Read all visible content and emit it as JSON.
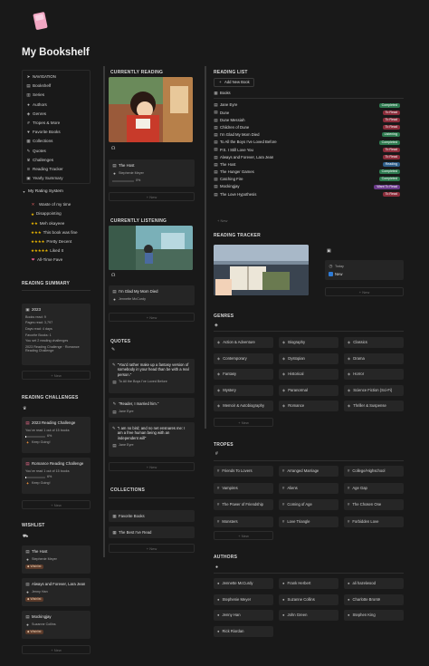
{
  "page": {
    "title": "My Bookshelf"
  },
  "navigation": {
    "title": "NAVIGATION",
    "items": [
      {
        "label": "Bookshelf"
      },
      {
        "label": "Series"
      },
      {
        "label": "Authors"
      },
      {
        "label": "Genres"
      },
      {
        "label": "Tropes & More"
      },
      {
        "label": "Favorite Books"
      },
      {
        "label": "Collections"
      },
      {
        "label": "Quotes"
      },
      {
        "label": "Challenges"
      },
      {
        "label": "Reading Tracker"
      },
      {
        "label": "Yearly Summary"
      }
    ]
  },
  "rating_system": {
    "title": "My Rating System",
    "items": [
      {
        "stars": "",
        "label": "Waste of my time"
      },
      {
        "stars": "★",
        "label": "Disappointing"
      },
      {
        "stars": "★★",
        "label": "Meh okayeee"
      },
      {
        "stars": "★★★",
        "label": "This book was fine"
      },
      {
        "stars": "★★★★",
        "label": "Pretty Decent"
      },
      {
        "stars": "★★★★★",
        "label": "Liked It"
      },
      {
        "stars": "",
        "label": "All-Time Fave"
      }
    ]
  },
  "reading_summary": {
    "title": "READING SUMMARY",
    "year": "2023",
    "lines": [
      "Books read: 9",
      "Pages read: 3,797",
      "Days read: 4 days",
      "Favorite Books: 1",
      "You set 2 reading challenges",
      "2023 Reading Challenge · Romance Reading Challenge"
    ],
    "new_label": "+ New"
  },
  "reading_challenges": {
    "title": "READING CHALLENGES",
    "items": [
      {
        "title": "2023 Reading Challenge",
        "detail": "You've read 1 out of 15 books",
        "percent": "6%",
        "status": "Keep Going!"
      },
      {
        "title": "Romance Reading Challenge",
        "detail": "You've read 1 out of 15 books",
        "percent": "6%",
        "status": "Keep Going!"
      }
    ],
    "new_label": "+ New"
  },
  "wishlist": {
    "title": "WISHLIST",
    "items": [
      {
        "title": "The Host",
        "author": "Stephenie Meyer",
        "tag": "Wishlist"
      },
      {
        "title": "Always and Forever, Lara Jean",
        "author": "Jenny Han",
        "tag": "Wishlist"
      },
      {
        "title": "Mockingjay",
        "author": "Suzanne Collins",
        "tag": "Wishlist"
      }
    ],
    "new_label": "+ New"
  },
  "currently_reading": {
    "title": "CURRENTLY READING",
    "book": "The Host",
    "author": "Stephenie Meyer",
    "progress_text": "0%",
    "progress": 0,
    "new_label": "+ New"
  },
  "currently_listening": {
    "title": "CURRENTLY LISTENING",
    "book": "I'm Glad My Mom Died",
    "author": "Jennette McCurdy",
    "new_label": "+ New"
  },
  "quotes": {
    "title": "QUOTES",
    "items": [
      {
        "text": "\"You'd rather make up a fantasy version of somebody in your head than be with a real person.\"",
        "source": "To All the Boys I've Loved Before"
      },
      {
        "text": "\"Reader, I married him.\"",
        "source": "Jane Eyre"
      },
      {
        "text": "\"I am no bird; and no net ensnares me: I am a free human being with an independent will\"",
        "source": "Jane Eyre"
      }
    ],
    "new_label": "+ New"
  },
  "collections": {
    "title": "COLLECTIONS",
    "items": [
      {
        "label": "Favorite Books"
      },
      {
        "label": "The Best I've Read"
      }
    ],
    "new_label": "+ New"
  },
  "reading_list": {
    "title": "READING LIST",
    "add_label": "Add New Book",
    "tab_label": "Books",
    "new_label": "+ New",
    "books": [
      {
        "title": "Jane Eyre",
        "status": "Completed",
        "color": "#2d7a4f"
      },
      {
        "title": "Dune",
        "status": "To Read",
        "color": "#8b2d3b"
      },
      {
        "title": "Dune Messiah",
        "status": "To Read",
        "color": "#8b2d3b"
      },
      {
        "title": "Children of Dune",
        "status": "To Read",
        "color": "#8b2d3b"
      },
      {
        "title": "I'm Glad My Mom Died",
        "status": "Listening",
        "color": "#2d7a4f"
      },
      {
        "title": "To All the Boys I've Loved Before",
        "status": "Completed",
        "color": "#2d7a4f"
      },
      {
        "title": "P.S. I Still Love You",
        "status": "To Read",
        "color": "#8b2d3b"
      },
      {
        "title": "Always and Forever, Lara Jean",
        "status": "To Read",
        "color": "#8b2d3b"
      },
      {
        "title": "The Host",
        "status": "Reading",
        "color": "#2e5e8a"
      },
      {
        "title": "The Hunger Games",
        "status": "Completed",
        "color": "#2d7a4f"
      },
      {
        "title": "Catching Fire",
        "status": "Completed",
        "color": "#2d7a4f"
      },
      {
        "title": "Mockingjay",
        "status": "Want To Read",
        "color": "#6a3a8a"
      },
      {
        "title": "The Love Hypothesis",
        "status": "To Read",
        "color": "#8b2d3b"
      }
    ]
  },
  "reading_tracker": {
    "title": "READING TRACKER",
    "today_label": "Today",
    "entry": "New",
    "new_label": "+ New"
  },
  "genres": {
    "title": "GENRES",
    "items": [
      {
        "label": "Action & Adventure"
      },
      {
        "label": "Biography"
      },
      {
        "label": "Classics"
      },
      {
        "label": "Contemporary"
      },
      {
        "label": "Dystopian"
      },
      {
        "label": "Drama"
      },
      {
        "label": "Fantasy"
      },
      {
        "label": "Historical"
      },
      {
        "label": "Horror"
      },
      {
        "label": "Mystery"
      },
      {
        "label": "Paranormal"
      },
      {
        "label": "Science Fiction (Sci-Fi)"
      },
      {
        "label": "Memoir & Autobiography"
      },
      {
        "label": "Romance"
      },
      {
        "label": "Thriller & Suspense"
      }
    ],
    "new_label": "+ New"
  },
  "tropes": {
    "title": "TROPES",
    "items": [
      {
        "label": "Friends To Lovers"
      },
      {
        "label": "Arranged Marriage"
      },
      {
        "label": "College/Highschool"
      },
      {
        "label": "Vampires"
      },
      {
        "label": "Aliens"
      },
      {
        "label": "Age Gap"
      },
      {
        "label": "The Power of Friendship"
      },
      {
        "label": "Coming of Age"
      },
      {
        "label": "The Chosen One"
      },
      {
        "label": "Monsters"
      },
      {
        "label": "Love Triangle"
      },
      {
        "label": "Forbidden Love"
      }
    ],
    "new_label": "+ New"
  },
  "authors": {
    "title": "AUTHORS",
    "items": [
      {
        "label": "Jennette McCurdy"
      },
      {
        "label": "Frank Herbert"
      },
      {
        "label": "ali hazelwood"
      },
      {
        "label": "Stephenie Meyer"
      },
      {
        "label": "Suzanne Collins"
      },
      {
        "label": "Charlotte Brontë"
      },
      {
        "label": "Jenny Han"
      },
      {
        "label": "John Green"
      },
      {
        "label": "Stephen King"
      },
      {
        "label": "Rick Riordan"
      }
    ],
    "new_label": "+ New"
  },
  "colors": {
    "bg": "#191919",
    "card": "#252525",
    "gold": "#e8b400"
  }
}
